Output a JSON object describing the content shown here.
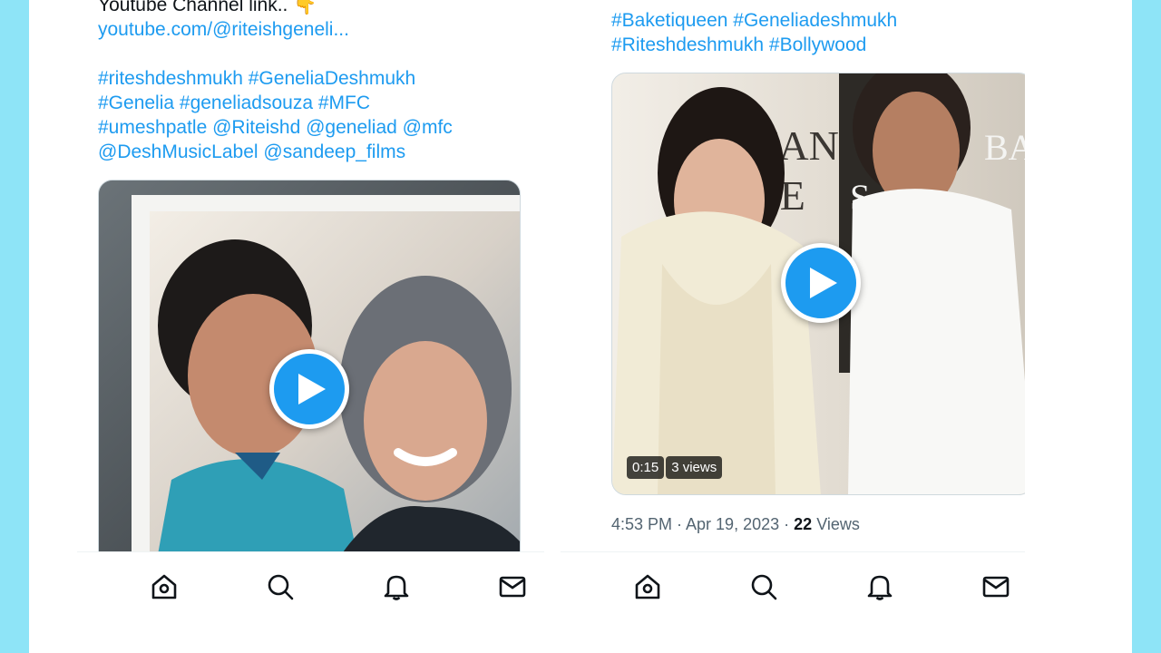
{
  "left_tweet": {
    "line_youtube_label": "Youtube Channel link..",
    "emoji": "👇",
    "youtube_link": "youtube.com/@riteishgeneli...",
    "hashtag_lines": [
      "#riteshdeshmukh #GeneliaDeshmukh",
      "#Genelia #geneliadsouza #MFC",
      "#umeshpatle @Riteishd @geneliad @mfc",
      "@DeshMusicLabel @sandeep_films"
    ],
    "media_type": "video"
  },
  "right_tweet": {
    "hashtag_lines": [
      "#Baketiqueen #Geneliadeshmukh",
      "#Riteshdeshmukh #Bollywood"
    ],
    "video_duration": "0:15",
    "video_views": "3 views",
    "timestamp": "4:53 PM · Apr 19, 2023 ·",
    "views_count": "22",
    "views_label": "Views"
  },
  "nav": {
    "items": [
      "home-icon",
      "search-icon",
      "bell-icon",
      "mail-icon"
    ]
  },
  "colors": {
    "background": "#8ee4f7",
    "link": "#1d9bf0",
    "muted": "#536471",
    "text": "#0f1419"
  }
}
